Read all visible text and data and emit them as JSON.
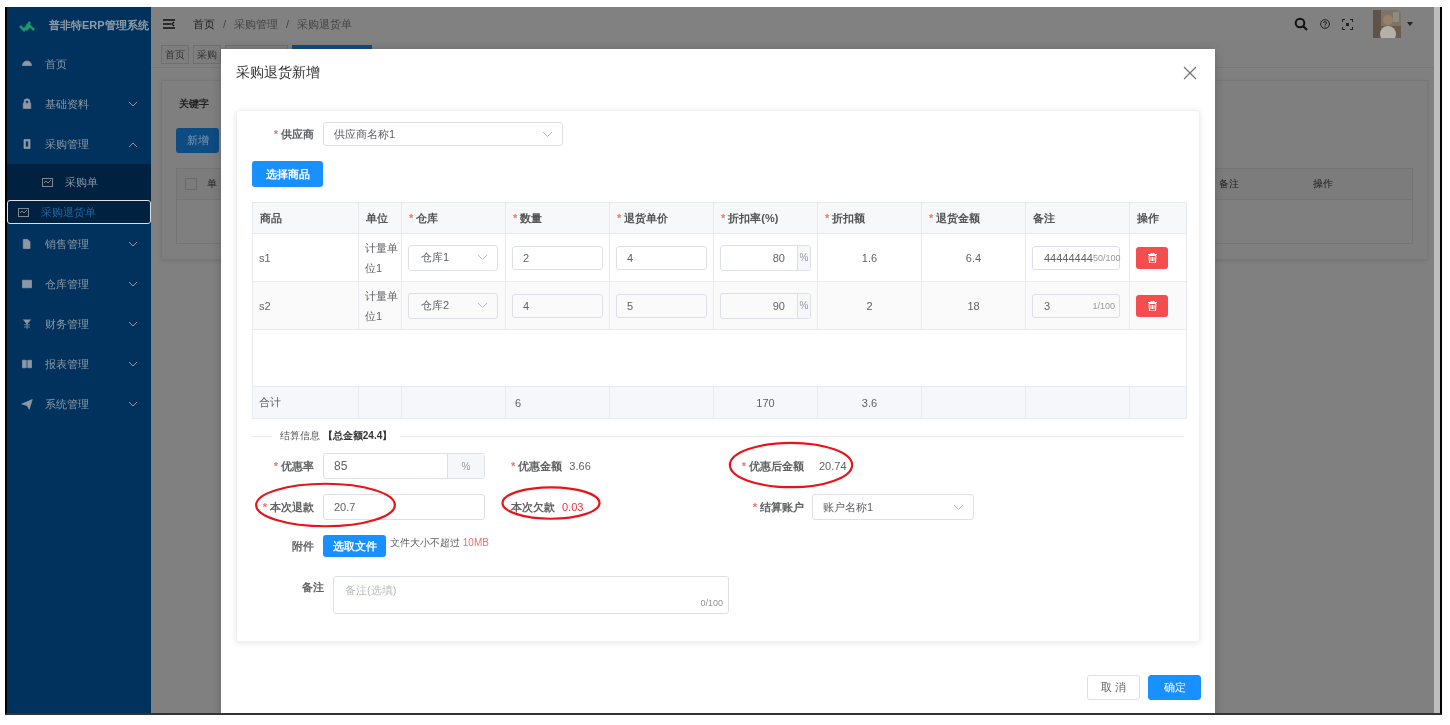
{
  "sidebar": {
    "title": "普非特ERP管理系统",
    "items": [
      {
        "label": "首页",
        "selected": false
      },
      {
        "label": "基础资料",
        "expanded": false,
        "selected": false
      },
      {
        "label": "采购管理",
        "expanded": true,
        "selected": false,
        "children": [
          {
            "label": "采购单",
            "selected": false
          },
          {
            "label": "采购退货单",
            "selected": true
          }
        ]
      },
      {
        "label": "销售管理",
        "expanded": false,
        "selected": false
      },
      {
        "label": "仓库管理",
        "expanded": false,
        "selected": false
      },
      {
        "label": "财务管理",
        "expanded": false,
        "selected": false
      },
      {
        "label": "报表管理",
        "expanded": false,
        "selected": false
      },
      {
        "label": "系统管理",
        "expanded": false,
        "selected": false
      }
    ]
  },
  "header": {
    "breadcrumb": [
      "首页",
      "采购管理",
      "采购退货单"
    ],
    "separator": "/"
  },
  "tags": [
    {
      "label": "首页",
      "selected": false
    },
    {
      "label": "采购",
      "selected": false
    },
    {
      "selected": false
    },
    {
      "selected": true
    }
  ],
  "page": {
    "filter_label": "关键字",
    "add_button": "新增",
    "select_all_checked": false,
    "columns": [
      "单",
      "备注",
      "操作"
    ]
  },
  "dialog": {
    "title": "采购退货新增",
    "required_mark": "*",
    "supplier": {
      "label": "供应商",
      "required": true,
      "value": "供应商名称1"
    },
    "select_goods_button": "选择商品",
    "table": {
      "columns": [
        {
          "label": "商品",
          "required": false
        },
        {
          "label": "单位",
          "required": false
        },
        {
          "label": "仓库",
          "required": true
        },
        {
          "label": "数量",
          "required": true
        },
        {
          "label": "退货单价",
          "required": true
        },
        {
          "label": "折扣率(%)",
          "required": true
        },
        {
          "label": "折扣额",
          "required": true
        },
        {
          "label": "退货金额",
          "required": true
        },
        {
          "label": "备注",
          "required": false
        },
        {
          "label": "操作",
          "required": false
        }
      ],
      "rows": [
        {
          "product": "s1",
          "unit": "计量单位1",
          "warehouse": "仓库1",
          "quantity": "2",
          "price": "4",
          "discount_rate": "80",
          "rate_suffix": "%",
          "discount_amount": "1.6",
          "amount": "6.4",
          "remark": "44444444",
          "remark_count": "50/100"
        },
        {
          "product": "s2",
          "unit": "计量单位1",
          "warehouse": "仓库2",
          "quantity": "4",
          "price": "5",
          "discount_rate": "90",
          "rate_suffix": "%",
          "discount_amount": "2",
          "amount": "18",
          "remark": "3",
          "remark_count": "1/100"
        }
      ],
      "summary": {
        "label": "合计",
        "quantity": "6",
        "discount_rate": "170",
        "discount_amount": "3.6"
      }
    },
    "settlement": {
      "title": "结算信息",
      "total": "【总金额24.4】",
      "fields": [
        {
          "kind": "input_suffix",
          "label": "优惠率",
          "required": true,
          "value": "85",
          "suffix": "%",
          "circled": false
        },
        {
          "kind": "text",
          "label": "优惠金额",
          "required": true,
          "value": "3.66",
          "alert": false,
          "circled": false
        },
        {
          "kind": "text",
          "label": "优惠后金额",
          "required": true,
          "value": "20.74",
          "alert": false,
          "circled": true
        },
        {
          "kind": "input",
          "label": "本次退款",
          "required": true,
          "value": "20.7",
          "circled": true
        },
        {
          "kind": "text",
          "label": "本次欠款",
          "required": false,
          "value": "0.03",
          "alert": true,
          "circled": true
        },
        {
          "kind": "select",
          "label": "结算账户",
          "required": true,
          "value": "账户名称1",
          "circled": false
        },
        {
          "kind": "upload",
          "label": "附件",
          "required": false,
          "button": "选取文件",
          "hint": "文件大小不超过",
          "hint_emph": "10MB",
          "circled": false
        },
        {
          "kind": "textarea",
          "label": "备注",
          "required": false,
          "placeholder": "备注(选填)",
          "count": "0/100",
          "circled": false
        }
      ]
    },
    "buttons": [
      {
        "label": "取 消",
        "primary": false
      },
      {
        "label": "确定",
        "primary": true
      }
    ]
  }
}
